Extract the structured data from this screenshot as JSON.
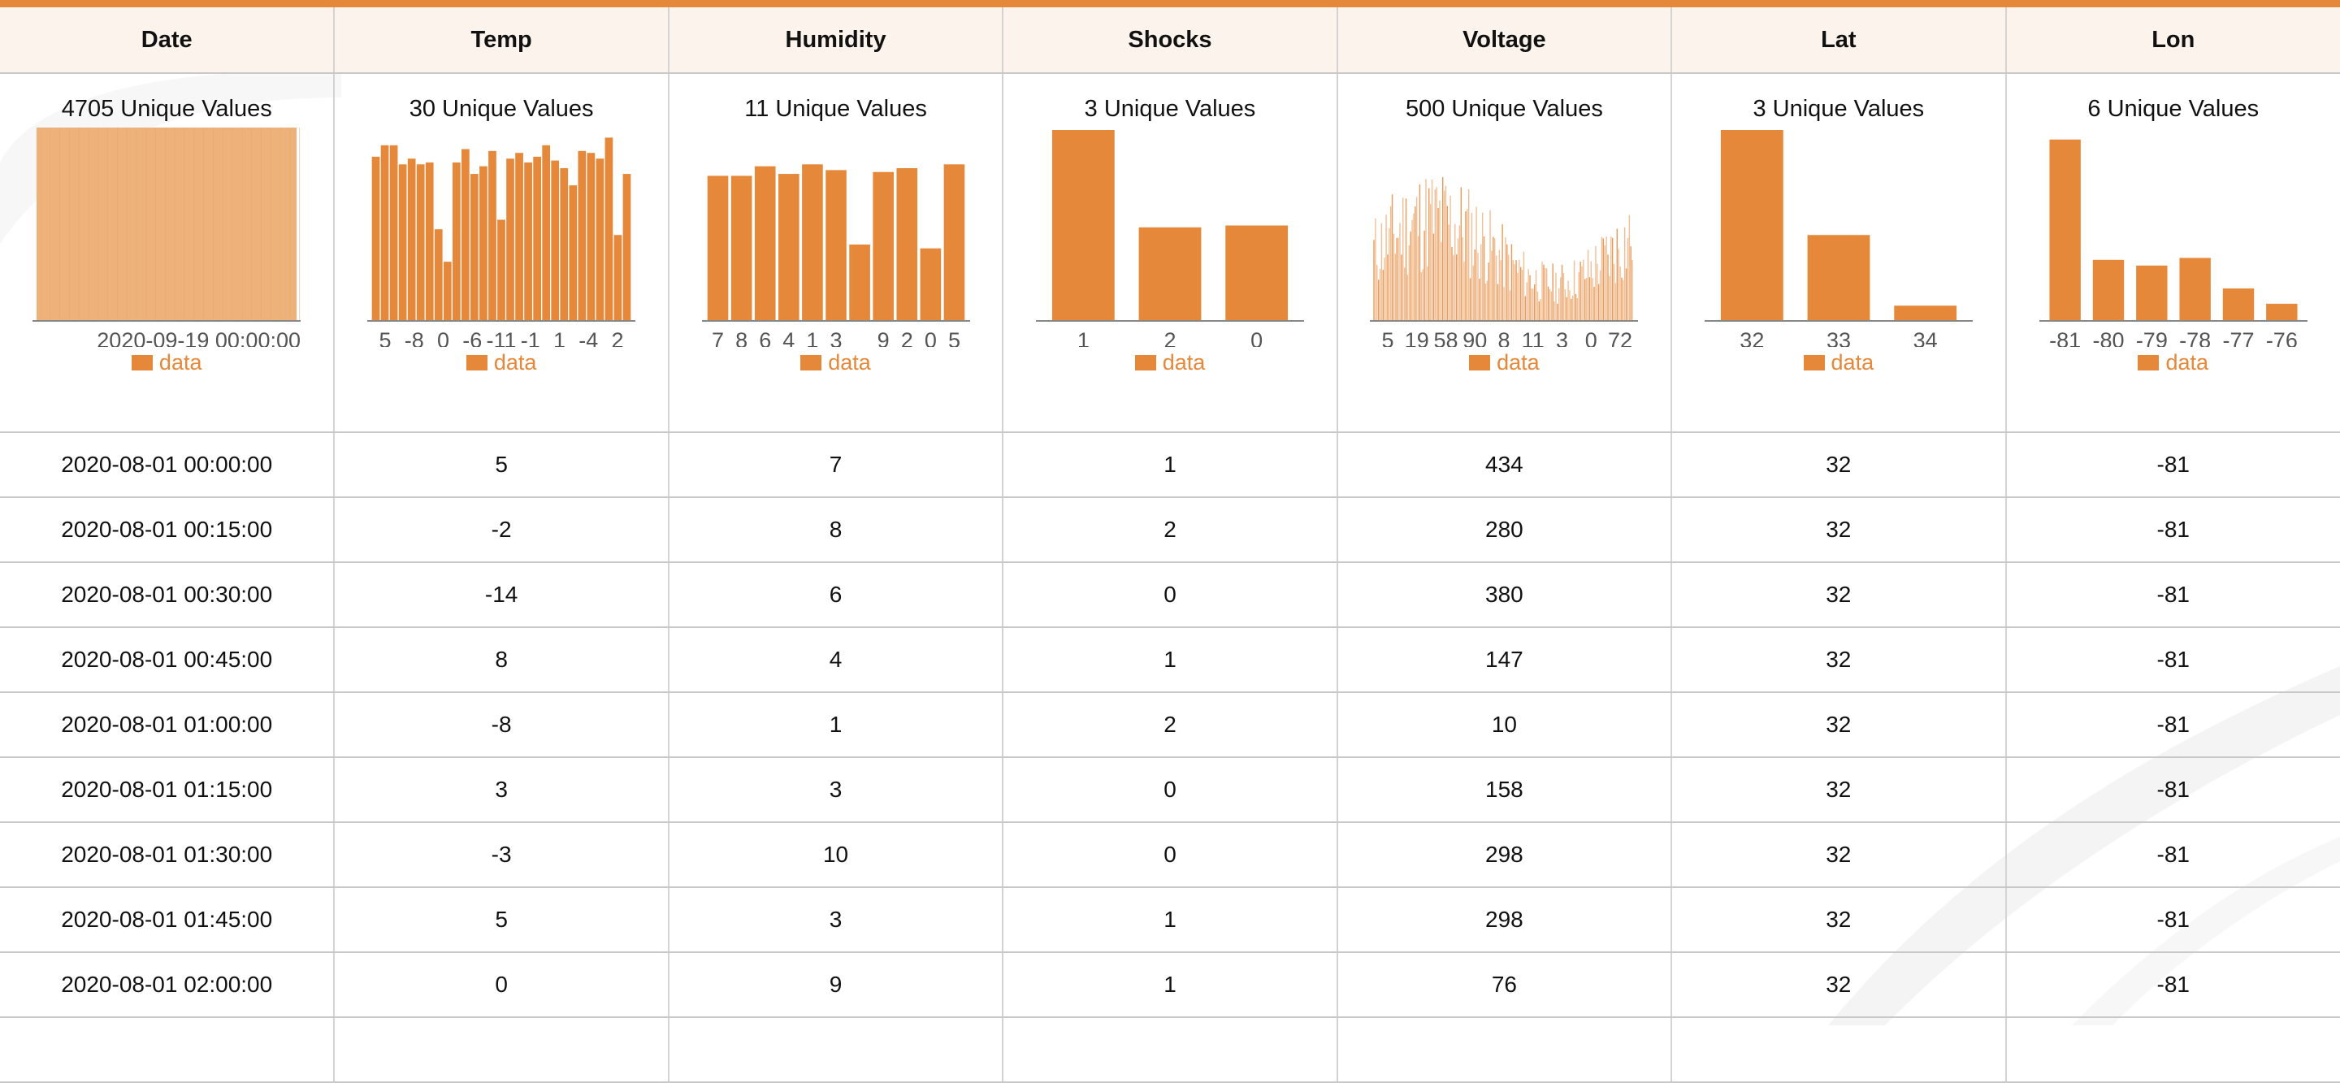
{
  "theme": {
    "accent": "#e5883a",
    "header_bg": "#fdf2ec"
  },
  "columns": [
    {
      "name": "Date",
      "unique_label": "4705 Unique Values",
      "legend_label": "data",
      "hist": {
        "kind": "dense",
        "ticks": [
          "2020-09-19 00:00:00"
        ]
      }
    },
    {
      "name": "Temp",
      "unique_label": "30 Unique Values",
      "legend_label": "data",
      "hist": {
        "kind": "bars",
        "ticks": [
          "5",
          "-8",
          "0",
          "-6",
          "-11",
          "-1",
          "1",
          "-4",
          "2"
        ],
        "values": [
          0.86,
          0.92,
          0.92,
          0.82,
          0.85,
          0.82,
          0.83,
          0.48,
          0.31,
          0.83,
          0.9,
          0.77,
          0.81,
          0.89,
          0.53,
          0.85,
          0.88,
          0.83,
          0.86,
          0.92,
          0.84,
          0.8,
          0.71,
          0.89,
          0.88,
          0.85,
          0.96,
          0.45,
          0.77
        ]
      }
    },
    {
      "name": "Humidity",
      "unique_label": "11 Unique Values",
      "legend_label": "data",
      "hist": {
        "kind": "bars",
        "ticks": [
          "7",
          "8",
          "6",
          "4",
          "1",
          "3",
          "",
          "9",
          "2",
          "0",
          "5"
        ],
        "values": [
          0.76,
          0.76,
          0.81,
          0.77,
          0.82,
          0.79,
          0.4,
          0.78,
          0.8,
          0.38,
          0.82
        ]
      }
    },
    {
      "name": "Shocks",
      "unique_label": "3 Unique Values",
      "legend_label": "data",
      "hist": {
        "kind": "bars",
        "ticks": [
          "1",
          "2",
          "0"
        ],
        "values": [
          1.0,
          0.49,
          0.5
        ]
      }
    },
    {
      "name": "Voltage",
      "unique_label": "500 Unique Values",
      "legend_label": "data",
      "hist": {
        "kind": "noise",
        "ticks": [
          "5",
          "19",
          "58",
          "90",
          "8",
          "11",
          "3",
          "0",
          "72"
        ]
      }
    },
    {
      "name": "Lat",
      "unique_label": "3 Unique Values",
      "legend_label": "data",
      "hist": {
        "kind": "bars",
        "ticks": [
          "32",
          "33",
          "34"
        ],
        "values": [
          1.0,
          0.45,
          0.08
        ]
      }
    },
    {
      "name": "Lon",
      "unique_label": "6 Unique Values",
      "legend_label": "data",
      "hist": {
        "kind": "bars",
        "ticks": [
          "-81",
          "-80",
          "-79",
          "-78",
          "-77",
          "-76"
        ],
        "values": [
          0.95,
          0.32,
          0.29,
          0.33,
          0.17,
          0.09
        ]
      }
    }
  ],
  "rows": [
    [
      "2020-08-01 00:00:00",
      "5",
      "7",
      "1",
      "434",
      "32",
      "-81"
    ],
    [
      "2020-08-01 00:15:00",
      "-2",
      "8",
      "2",
      "280",
      "32",
      "-81"
    ],
    [
      "2020-08-01 00:30:00",
      "-14",
      "6",
      "0",
      "380",
      "32",
      "-81"
    ],
    [
      "2020-08-01 00:45:00",
      "8",
      "4",
      "1",
      "147",
      "32",
      "-81"
    ],
    [
      "2020-08-01 01:00:00",
      "-8",
      "1",
      "2",
      "10",
      "32",
      "-81"
    ],
    [
      "2020-08-01 01:15:00",
      "3",
      "3",
      "0",
      "158",
      "32",
      "-81"
    ],
    [
      "2020-08-01 01:30:00",
      "-3",
      "10",
      "0",
      "298",
      "32",
      "-81"
    ],
    [
      "2020-08-01 01:45:00",
      "5",
      "3",
      "1",
      "298",
      "32",
      "-81"
    ],
    [
      "2020-08-01 02:00:00",
      "0",
      "9",
      "1",
      "76",
      "32",
      "-81"
    ],
    [
      "",
      "",
      "",
      "",
      "",
      "",
      ""
    ]
  ]
}
